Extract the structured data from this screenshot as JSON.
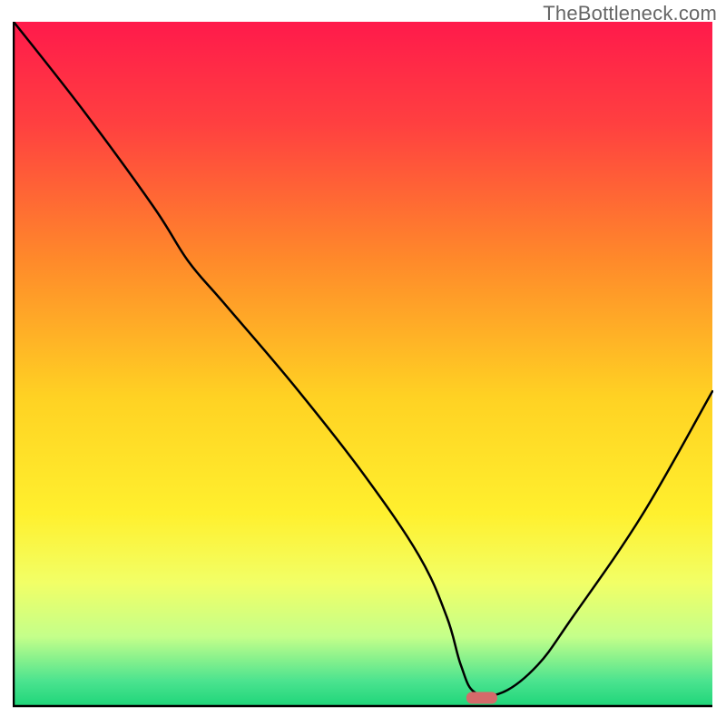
{
  "watermark": "TheBottleneck.com",
  "chart_data": {
    "type": "line",
    "title": "",
    "xlabel": "",
    "ylabel": "",
    "xlim": [
      0,
      100
    ],
    "ylim": [
      0,
      100
    ],
    "grid": false,
    "legend": false,
    "series": [
      {
        "name": "bottleneck-curve",
        "x": [
          0,
          10,
          20,
          25,
          30,
          40,
          50,
          58,
          62,
          64,
          66,
          70,
          75,
          80,
          90,
          100
        ],
        "y": [
          100,
          87,
          73,
          65,
          59,
          47,
          34,
          22,
          13,
          6,
          2,
          2,
          6,
          13,
          28,
          46
        ]
      }
    ],
    "annotations": [
      {
        "name": "optimal-marker",
        "x": 67,
        "y": 1.2,
        "shape": "pill",
        "color": "#d46a6a"
      }
    ],
    "background_gradient": {
      "stops": [
        {
          "pos": 0.0,
          "color": "#ff1a4b"
        },
        {
          "pos": 0.15,
          "color": "#ff4040"
        },
        {
          "pos": 0.35,
          "color": "#ff8a2a"
        },
        {
          "pos": 0.55,
          "color": "#ffd223"
        },
        {
          "pos": 0.72,
          "color": "#fff02e"
        },
        {
          "pos": 0.82,
          "color": "#f2ff66"
        },
        {
          "pos": 0.9,
          "color": "#c4ff8a"
        },
        {
          "pos": 0.965,
          "color": "#4be38f"
        },
        {
          "pos": 1.0,
          "color": "#20d67a"
        }
      ]
    }
  }
}
